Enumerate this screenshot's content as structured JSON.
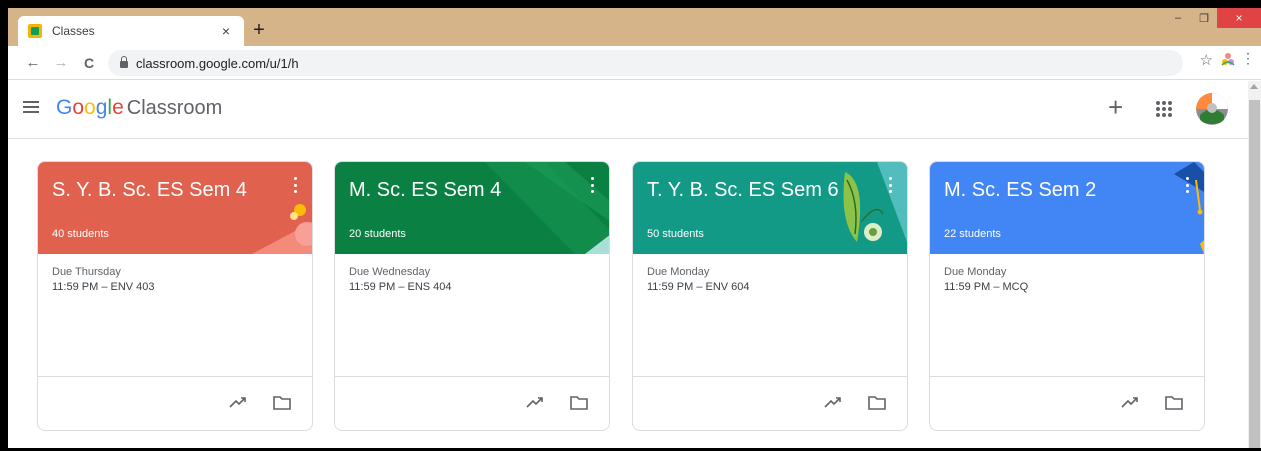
{
  "browser": {
    "tab_title": "Classes",
    "tab_close": "×",
    "new_tab": "+",
    "url": "classroom.google.com/u/1/h",
    "back": "←",
    "forward": "→",
    "reload": "C",
    "minimize": "‒",
    "restore": "❐",
    "close": "×"
  },
  "app": {
    "logo": [
      "G",
      "o",
      "o",
      "g",
      "l",
      "e"
    ],
    "product": "Classroom",
    "create": "+"
  },
  "classes": [
    {
      "title": "S. Y. B. Sc. ES Sem 4",
      "students": "40 students",
      "due_label": "Due Thursday",
      "due_item": "11:59 PM – ENV 403",
      "color": "#e1614f"
    },
    {
      "title": "M. Sc. ES Sem 4",
      "students": "20 students",
      "due_label": "Due Wednesday",
      "due_item": "11:59 PM – ENS 404",
      "color": "#0b8043"
    },
    {
      "title": "T. Y. B. Sc. ES Sem 6",
      "students": "50 students",
      "due_label": "Due Monday",
      "due_item": "11:59 PM – ENV 604",
      "color": "#129a87"
    },
    {
      "title": "M. Sc. ES Sem 2",
      "students": "22 students",
      "due_label": "Due Monday",
      "due_item": "11:59 PM – MCQ",
      "color": "#4285f4"
    }
  ],
  "icons": {
    "trend": "trending-up-icon",
    "folder": "folder-icon",
    "more": "more-vert-icon"
  }
}
